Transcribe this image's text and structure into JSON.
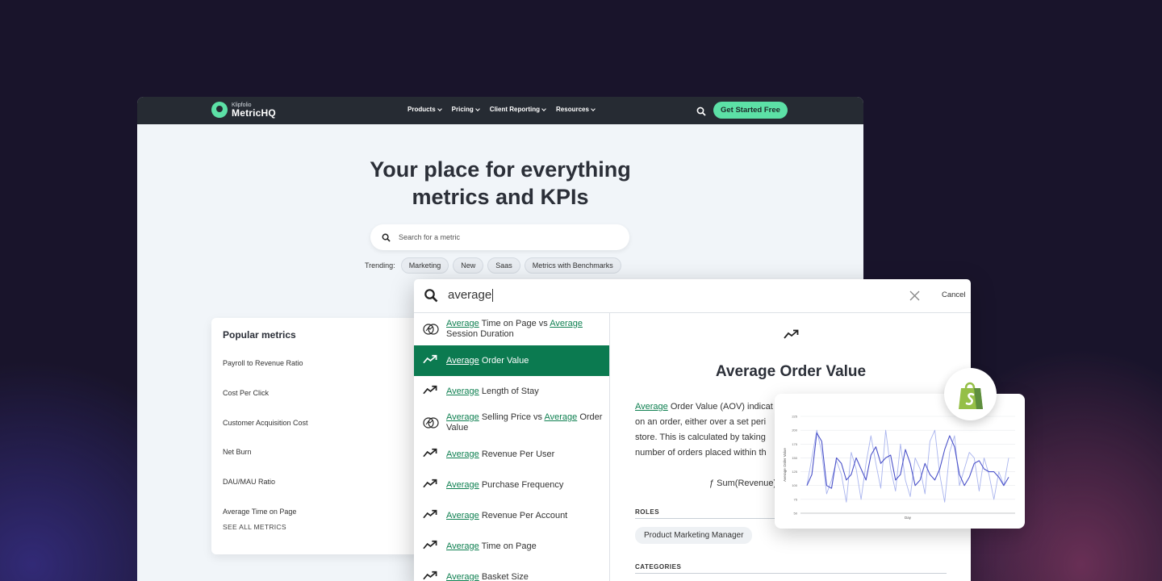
{
  "nav": {
    "logo_top": "Klipfolio",
    "logo_main": "MetricHQ",
    "menu": [
      "Products",
      "Pricing",
      "Client Reporting",
      "Resources"
    ],
    "cta": "Get Started Free"
  },
  "hero": {
    "title_line1": "Your place for everything",
    "title_line2": "metrics and KPIs",
    "search_placeholder": "Search for a metric",
    "trending_label": "Trending:",
    "trending": [
      "Marketing",
      "New",
      "Saas",
      "Metrics with Benchmarks"
    ]
  },
  "popular": {
    "title": "Popular metrics",
    "items": [
      "Payroll to Revenue Ratio",
      "Cost Per Click",
      "Customer Acquisition Cost",
      "Net Burn",
      "DAU/MAU Ratio",
      "Average Time on Page"
    ],
    "see_all": "SEE ALL METRICS"
  },
  "overlay": {
    "query": "average",
    "cancel": "Cancel",
    "results": [
      {
        "hl": "Average",
        "rest": " Time on Page vs ",
        "hl2": "Average",
        "rest2": " Session Duration",
        "icon": "compare-icon"
      },
      {
        "hl": "Average",
        "rest": " Order Value",
        "icon": "trend-icon",
        "active": true
      },
      {
        "hl": "Average",
        "rest": " Length of Stay",
        "icon": "trend-icon"
      },
      {
        "hl": "Average",
        "rest": " Selling Price vs ",
        "hl2": "Average",
        "rest2": " Order Value",
        "icon": "compare-icon"
      },
      {
        "hl": "Average",
        "rest": " Revenue Per User",
        "icon": "trend-icon"
      },
      {
        "hl": "Average",
        "rest": " Purchase Frequency",
        "icon": "trend-icon"
      },
      {
        "hl": "Average",
        "rest": " Revenue Per Account",
        "icon": "trend-icon"
      },
      {
        "hl": "Average",
        "rest": " Time on Page",
        "icon": "trend-icon"
      },
      {
        "hl": "Average",
        "rest": " Basket Size",
        "icon": "trend-icon"
      }
    ],
    "detail": {
      "title": "Average Order Value",
      "desc_hl": "Average",
      "desc_l1": " Order Value (AOV) indicat",
      "desc_l2": "on an order, either over a set peri",
      "desc_l3": "store. This is calculated by taking",
      "desc_l4": "number of orders placed within th",
      "formula": "ƒ Sum(Revenue)",
      "roles_label": "ROLES",
      "role": "Product Marketing Manager",
      "categories_label": "CATEGORIES"
    }
  },
  "chart_data": {
    "type": "line",
    "xlabel": "Day",
    "ylabel": "Average Order Value",
    "yticks": [
      50,
      75,
      100,
      125,
      150,
      175,
      200,
      225
    ],
    "ylim": [
      50,
      225
    ],
    "series": [
      {
        "values": [
          100,
          150,
          200,
          160,
          85,
          110,
          145,
          120,
          70,
          160,
          130,
          75,
          140,
          190,
          140,
          95,
          200,
          130,
          90,
          175,
          110,
          80,
          150,
          130,
          85,
          180,
          200,
          120,
          70,
          160,
          190,
          100,
          130,
          160,
          150,
          90,
          150,
          120,
          75,
          125,
          100,
          150
        ]
      },
      {
        "values": [
          100,
          120,
          195,
          180,
          100,
          95,
          150,
          140,
          110,
          120,
          150,
          130,
          110,
          155,
          170,
          140,
          150,
          155,
          110,
          120,
          165,
          140,
          100,
          110,
          140,
          120,
          110,
          130,
          165,
          190,
          170,
          120,
          100,
          115,
          140,
          145,
          130,
          125,
          125,
          115,
          100,
          115
        ]
      }
    ],
    "colors": {
      "raw": "#a9b4ee",
      "smooth": "#4b52c9"
    }
  }
}
